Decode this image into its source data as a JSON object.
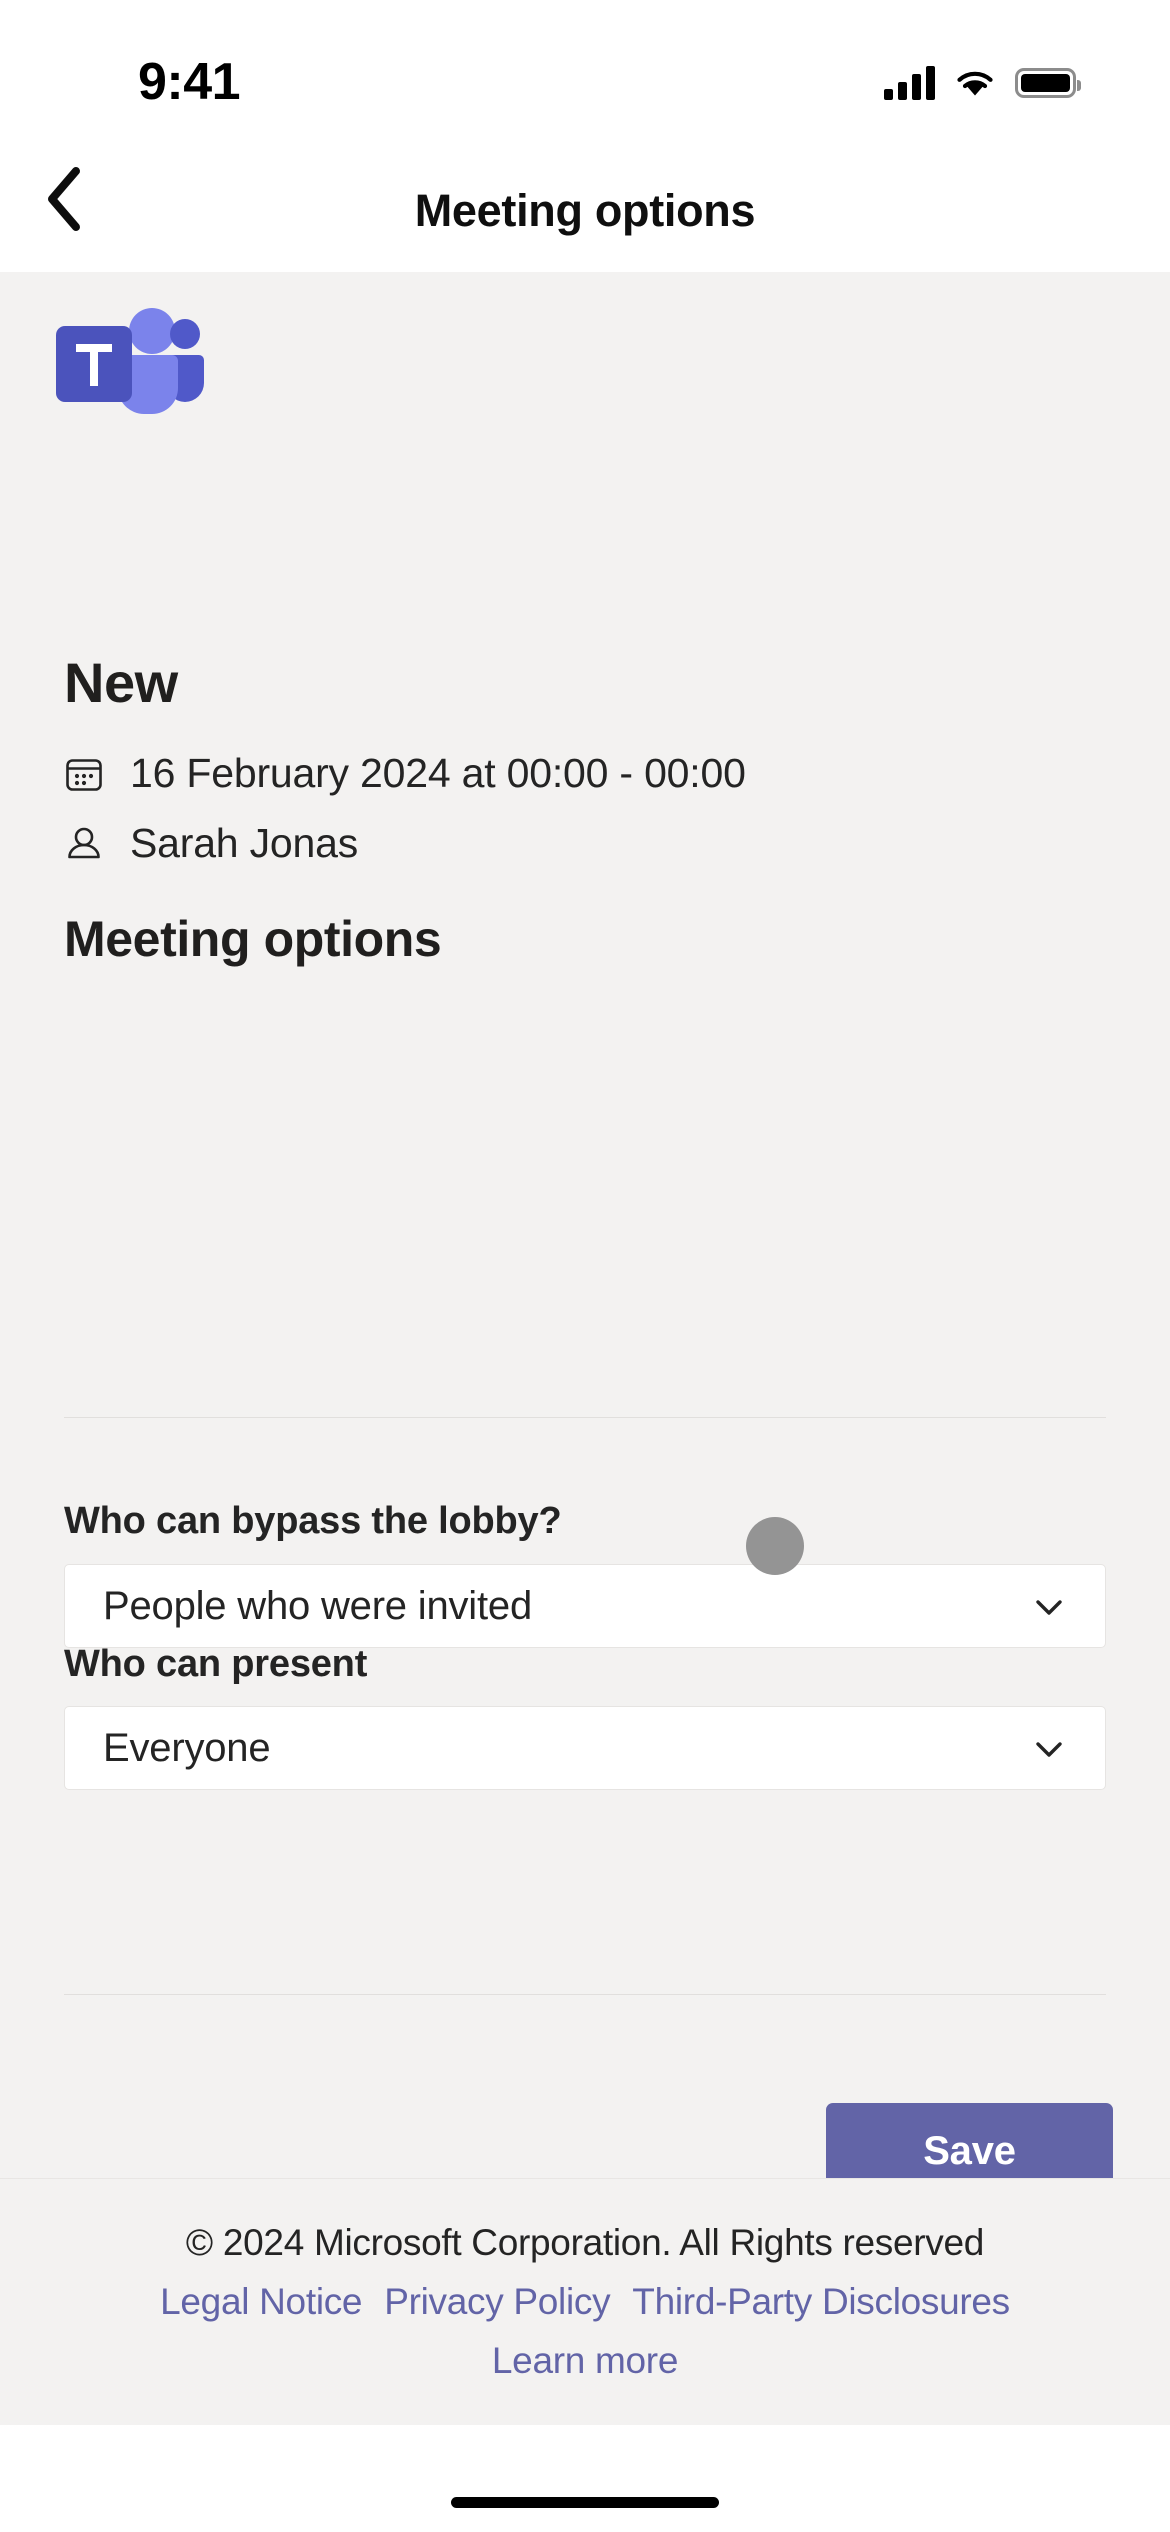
{
  "status_bar": {
    "time": "9:41",
    "signal_icon": "cellular-signal-icon",
    "wifi_icon": "wifi-icon",
    "battery_icon": "battery-full-icon"
  },
  "header": {
    "back_icon": "back-chevron-icon",
    "title": "Meeting options"
  },
  "app": {
    "logo_icon": "microsoft-teams-logo",
    "logo_letter": "T"
  },
  "meeting": {
    "title": "New",
    "date_icon": "calendar-icon",
    "date_text": "16 February 2024 at 00:00 - 00:00",
    "organizer_icon": "person-icon",
    "organizer_name": "Sarah Jonas"
  },
  "options": {
    "section_title": "Meeting options",
    "fields": [
      {
        "label": "Who can bypass the lobby?",
        "value": "People who were invited",
        "chevron_icon": "chevron-down-icon"
      },
      {
        "label": "Who can present",
        "value": "Everyone",
        "chevron_icon": "chevron-down-icon"
      }
    ],
    "save_label": "Save"
  },
  "footer": {
    "copyright": "© 2024 Microsoft Corporation. All Rights reserved",
    "links": [
      "Legal Notice",
      "Privacy Policy",
      "Third-Party Disclosures"
    ],
    "learn_more": "Learn more"
  },
  "colors": {
    "accent": "#6264A7",
    "page_background": "#F3F2F1",
    "surface": "#FFFFFF",
    "text_primary": "#242424",
    "touch_indicator": "#949494"
  }
}
